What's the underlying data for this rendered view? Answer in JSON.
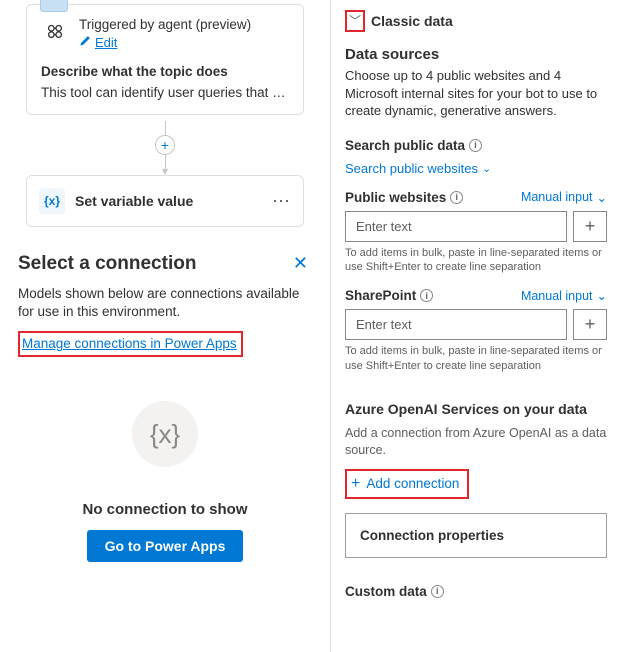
{
  "canvas": {
    "trigger": {
      "title": "Triggered by agent (preview)",
      "edit_label": "Edit"
    },
    "describe_label": "Describe what the topic does",
    "describe_value": "This tool can identify user queries that seek f…",
    "action": {
      "icon_text": "{x}",
      "title": "Set variable value"
    }
  },
  "select_panel": {
    "title": "Select a connection",
    "description": "Models shown below are connections available for use in this environment.",
    "manage_link": "Manage connections in Power Apps",
    "empty_icon_text": "{x}",
    "empty_text": "No connection to show",
    "go_button": "Go to Power Apps"
  },
  "right": {
    "classic": "Classic data",
    "data_sources_head": "Data sources",
    "data_sources_desc": "Choose up to 4 public websites and 4 Microsoft internal sites for your bot to use to create dynamic, generative answers.",
    "search_public_head": "Search public data",
    "search_public_link": "Search public websites",
    "public_sites_label": "Public websites",
    "manual_input": "Manual input",
    "enter_text_placeholder": "Enter text",
    "bulk_hint": "To add items in bulk, paste in line-separated items or use Shift+Enter to create line separation",
    "sharepoint_label": "SharePoint",
    "azure_head": "Azure OpenAI Services on your data",
    "azure_desc": "Add a connection from Azure OpenAI as a data source.",
    "add_connection": "Add connection",
    "conn_props": "Connection properties",
    "custom_data": "Custom data"
  }
}
